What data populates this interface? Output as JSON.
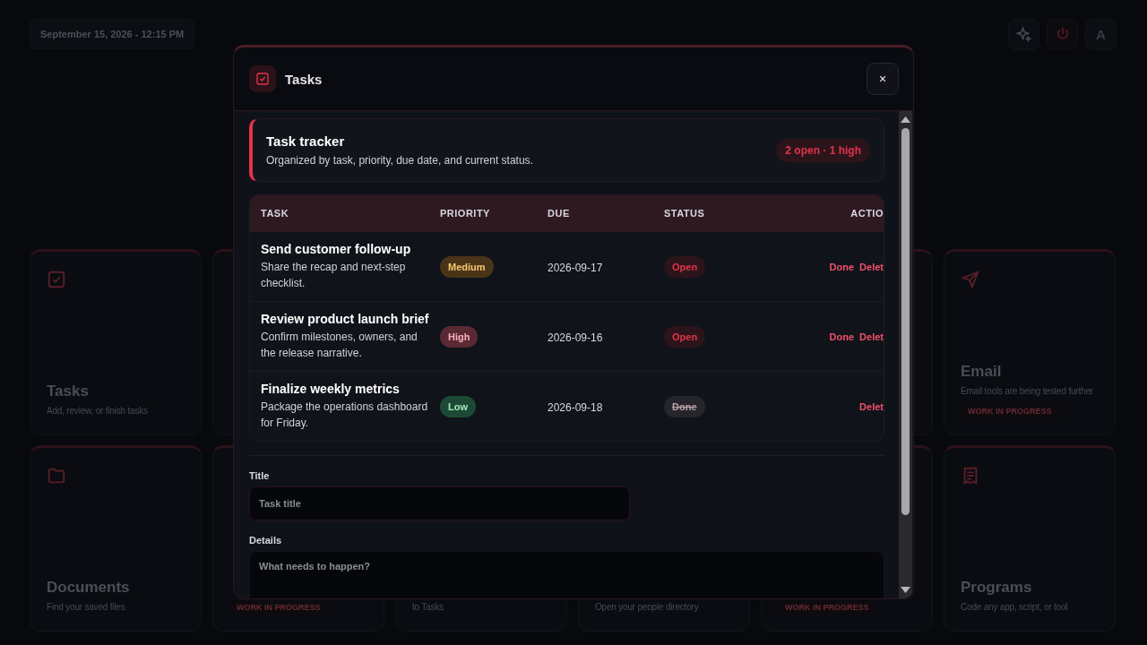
{
  "datetime": "September 15, 2026 - 12:15 PM",
  "top_actions": [
    {
      "kind": "sparkle"
    },
    {
      "kind": "power"
    },
    {
      "kind": "letter",
      "label": "A"
    }
  ],
  "card_rows": [
    {
      "leading": [
        {
          "kind": "checklist",
          "title": "Tasks",
          "description": [
            "Add, review, or finish tasks"
          ]
        }
      ],
      "trailing": [
        {
          "kind": "send",
          "title": "Email",
          "description": [
            "Email tools are being tested further"
          ],
          "badge": "WORK IN PROGRESS"
        }
      ]
    },
    {
      "leading": [
        {
          "kind": "folder",
          "title": "Documents",
          "description": [
            "Find your saved files"
          ]
        },
        {
          "badge": "WORK IN PROGRESS"
        },
        {
          "description": [
            "to Tasks"
          ]
        },
        {
          "description": [
            "Open your people directory"
          ]
        },
        {
          "badge": "WORK IN PROGRESS"
        },
        {
          "kind": "document",
          "title": "Programs",
          "description": [
            "Code any app, script, or tool"
          ]
        }
      ],
      "trailing": []
    }
  ],
  "modal": {
    "title": "Tasks",
    "close": "×",
    "summary": {
      "title": "Task tracker",
      "subtitle": "Organized by task, priority, due date, and current status.",
      "badge": "2 open · 1 high"
    },
    "table": {
      "columns": [
        "TASK",
        "PRIORITY",
        "DUE",
        "STATUS",
        "ACTIO"
      ],
      "rows": [
        {
          "title": "Send customer follow-up",
          "details": "Share the recap and next-step checklist.",
          "priority": {
            "label": "Medium",
            "kind": "medium"
          },
          "due": "2026-09-17",
          "status": {
            "label": "Open",
            "done": false
          },
          "actions": [
            "Done",
            "Delet"
          ]
        },
        {
          "title": "Review product launch brief",
          "details": "Confirm milestones, owners, and the release narrative.",
          "priority": {
            "label": "High",
            "kind": "high"
          },
          "due": "2026-09-16",
          "status": {
            "label": "Open",
            "done": false
          },
          "actions": [
            "Done",
            "Delet"
          ]
        },
        {
          "title": "Finalize weekly metrics",
          "details": "Package the operations dashboard for Friday.",
          "priority": {
            "label": "Low",
            "kind": "low"
          },
          "due": "2026-09-18",
          "status": {
            "label": "Done",
            "done": true
          },
          "actions": [
            "Delet"
          ]
        }
      ]
    },
    "form": {
      "title_label": "Title",
      "title_placeholder": "Task title",
      "details_label": "Details",
      "details_placeholder": "What needs to happen?"
    }
  }
}
